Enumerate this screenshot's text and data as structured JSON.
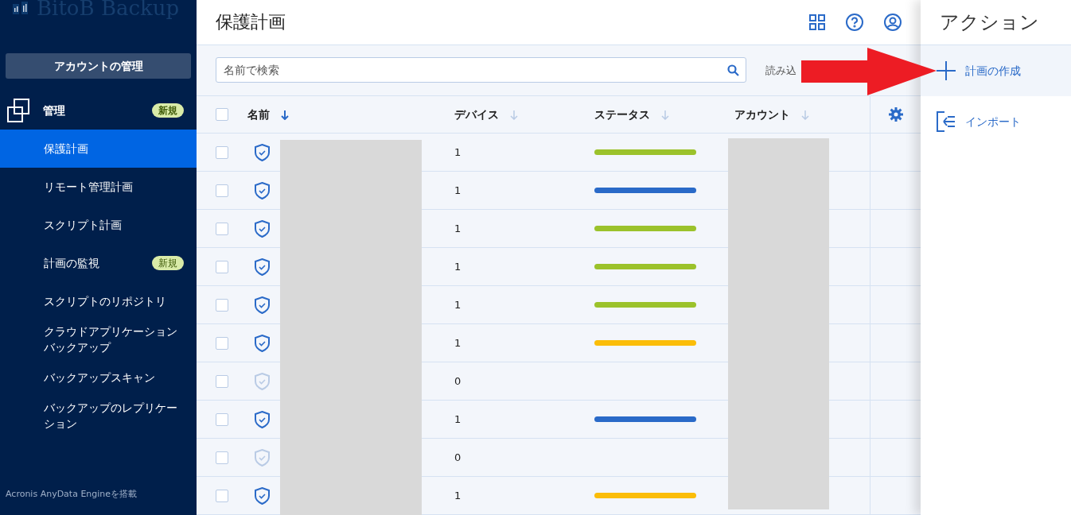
{
  "sidebar": {
    "logo": "BitoB Backup",
    "account_button": "アカウントの管理",
    "nav": [
      {
        "label": "管理",
        "badge": "新規",
        "selected": false,
        "children": [
          {
            "label": "保護計画",
            "selected": true
          },
          {
            "label": "リモート管理計画",
            "selected": false
          },
          {
            "label": "スクリプト計画",
            "selected": false
          },
          {
            "label": "計画の監視",
            "badge": "新規",
            "selected": false
          },
          {
            "label": "スクリプトのリポジトリ",
            "selected": false
          },
          {
            "label": "クラウドアプリケーションバックアップ",
            "selected": false
          },
          {
            "label": "バックアップスキャン",
            "selected": false
          },
          {
            "label": "バックアップのレプリケーション",
            "selected": false
          }
        ]
      }
    ],
    "footer": "Acronis AnyData Engineを搭載"
  },
  "header": {
    "title": "保護計画"
  },
  "toolbar": {
    "search": {
      "placeholder": "名前で検索"
    },
    "load_label": "読み込"
  },
  "table": {
    "select_all_checked": false,
    "columns": [
      {
        "label": "名前",
        "sorted": true
      },
      {
        "label": "デバイス",
        "sorted": false
      },
      {
        "label": "ステータス",
        "sorted": false
      },
      {
        "label": "アカウント",
        "sorted": false
      }
    ],
    "rows": [
      {
        "checked": false,
        "active": true,
        "devices": "1",
        "color": "#9bc22b"
      },
      {
        "checked": false,
        "active": true,
        "devices": "1",
        "color": "#2a6ac8"
      },
      {
        "checked": false,
        "active": true,
        "devices": "1",
        "color": "#9bc22b"
      },
      {
        "checked": false,
        "active": true,
        "devices": "1",
        "color": "#9bc22b"
      },
      {
        "checked": false,
        "active": true,
        "devices": "1",
        "color": "#9bc22b"
      },
      {
        "checked": false,
        "active": true,
        "devices": "1",
        "color": "#fbbd08"
      },
      {
        "checked": false,
        "active": false,
        "devices": "0"
      },
      {
        "checked": false,
        "active": true,
        "devices": "1",
        "color": "#2a6ac8"
      },
      {
        "checked": false,
        "active": false,
        "devices": "0"
      },
      {
        "checked": false,
        "active": true,
        "devices": "1",
        "color": "#fbbd08"
      }
    ]
  },
  "actions": {
    "title": "アクション",
    "items": [
      {
        "kind": "create",
        "label": "計画の作成",
        "selected": true
      },
      {
        "kind": "import",
        "label": "インポート",
        "selected": false
      }
    ]
  }
}
